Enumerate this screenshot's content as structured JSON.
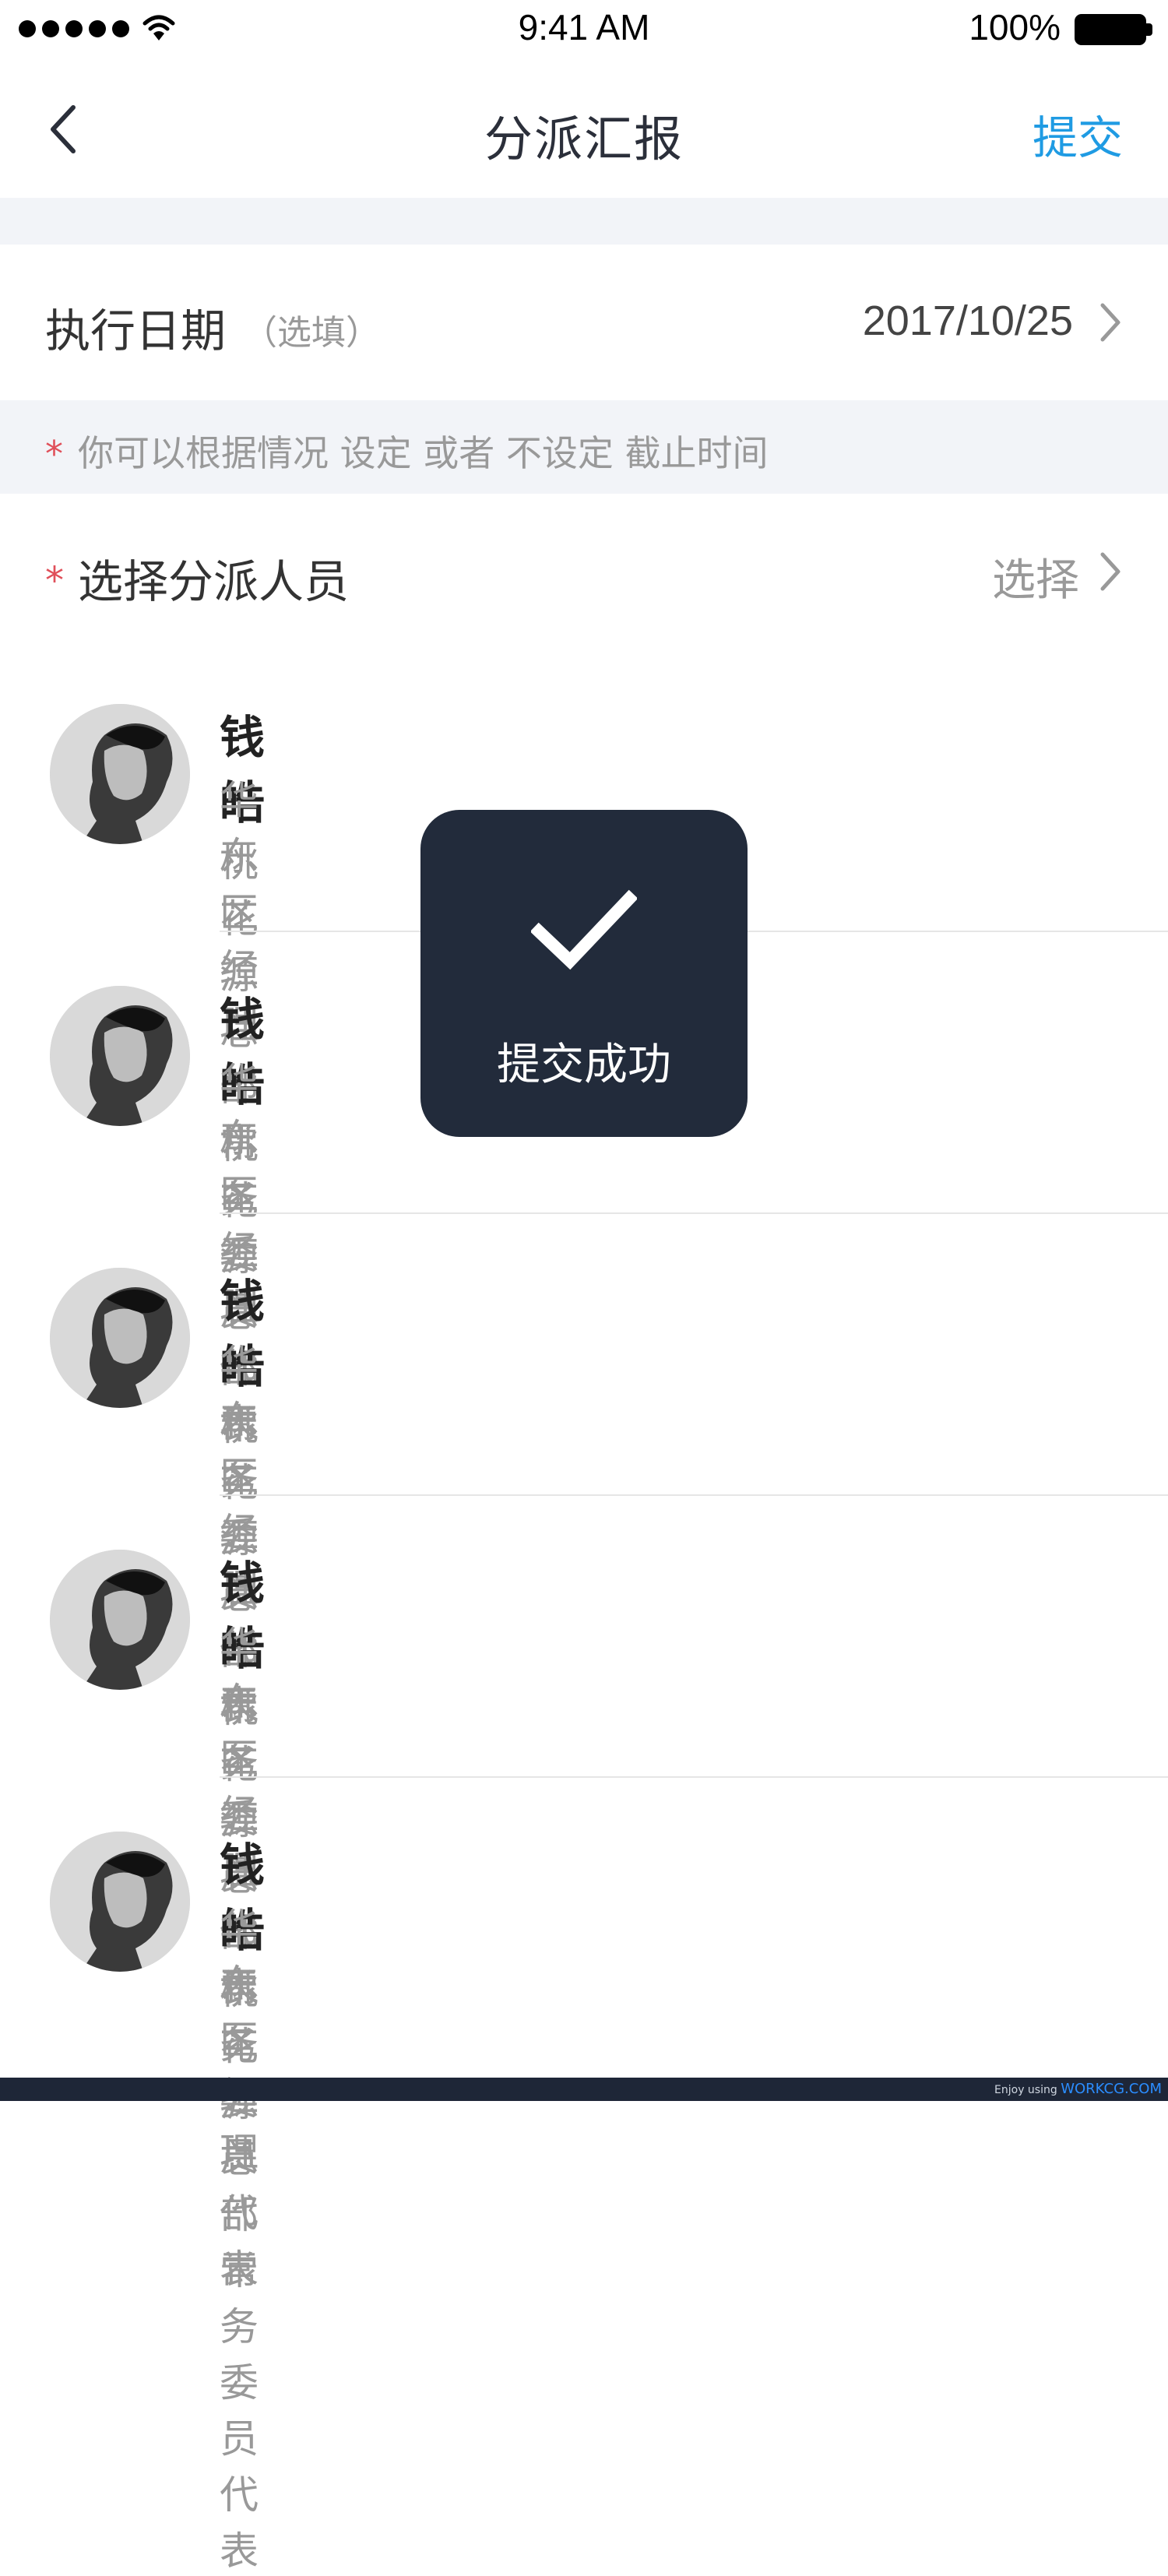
{
  "status_bar": {
    "time": "9:41 AM",
    "battery": "100%"
  },
  "nav": {
    "title": "分派汇报",
    "submit_label": "提交"
  },
  "date_field": {
    "label": "执行日期",
    "hint": "（选填）",
    "value": "2017/10/25"
  },
  "date_note": {
    "star": "*",
    "text": "你可以根据情况 设定 或者 不设定 截止时间"
  },
  "assignee": {
    "star": "*",
    "label": "选择分派人员",
    "action": "选择"
  },
  "people": [
    {
      "name": "钱皓",
      "role": "华东区经理",
      "org": "桃花源总部常务委员代表"
    },
    {
      "name": "钱皓",
      "role": "华东区经理",
      "org": "桃花源总部常务委员代表"
    },
    {
      "name": "钱皓",
      "role": "华东区经理",
      "org": "桃花源总部常务委员代表"
    },
    {
      "name": "钱皓",
      "role": "华东区经理",
      "org": "桃花源总部常务委员代表"
    },
    {
      "name": "钱皓",
      "role": "华东区经理",
      "org": "桃花源总部常务委员代表"
    }
  ],
  "toast": {
    "text": "提交成功",
    "icon": "checkmark-icon"
  },
  "footer": {
    "prefix": "Enjoy using",
    "link": "WORKCG.COM"
  },
  "colors": {
    "accent": "#1f9be3",
    "required": "#e0505a",
    "toast_bg": "#222b3b"
  }
}
